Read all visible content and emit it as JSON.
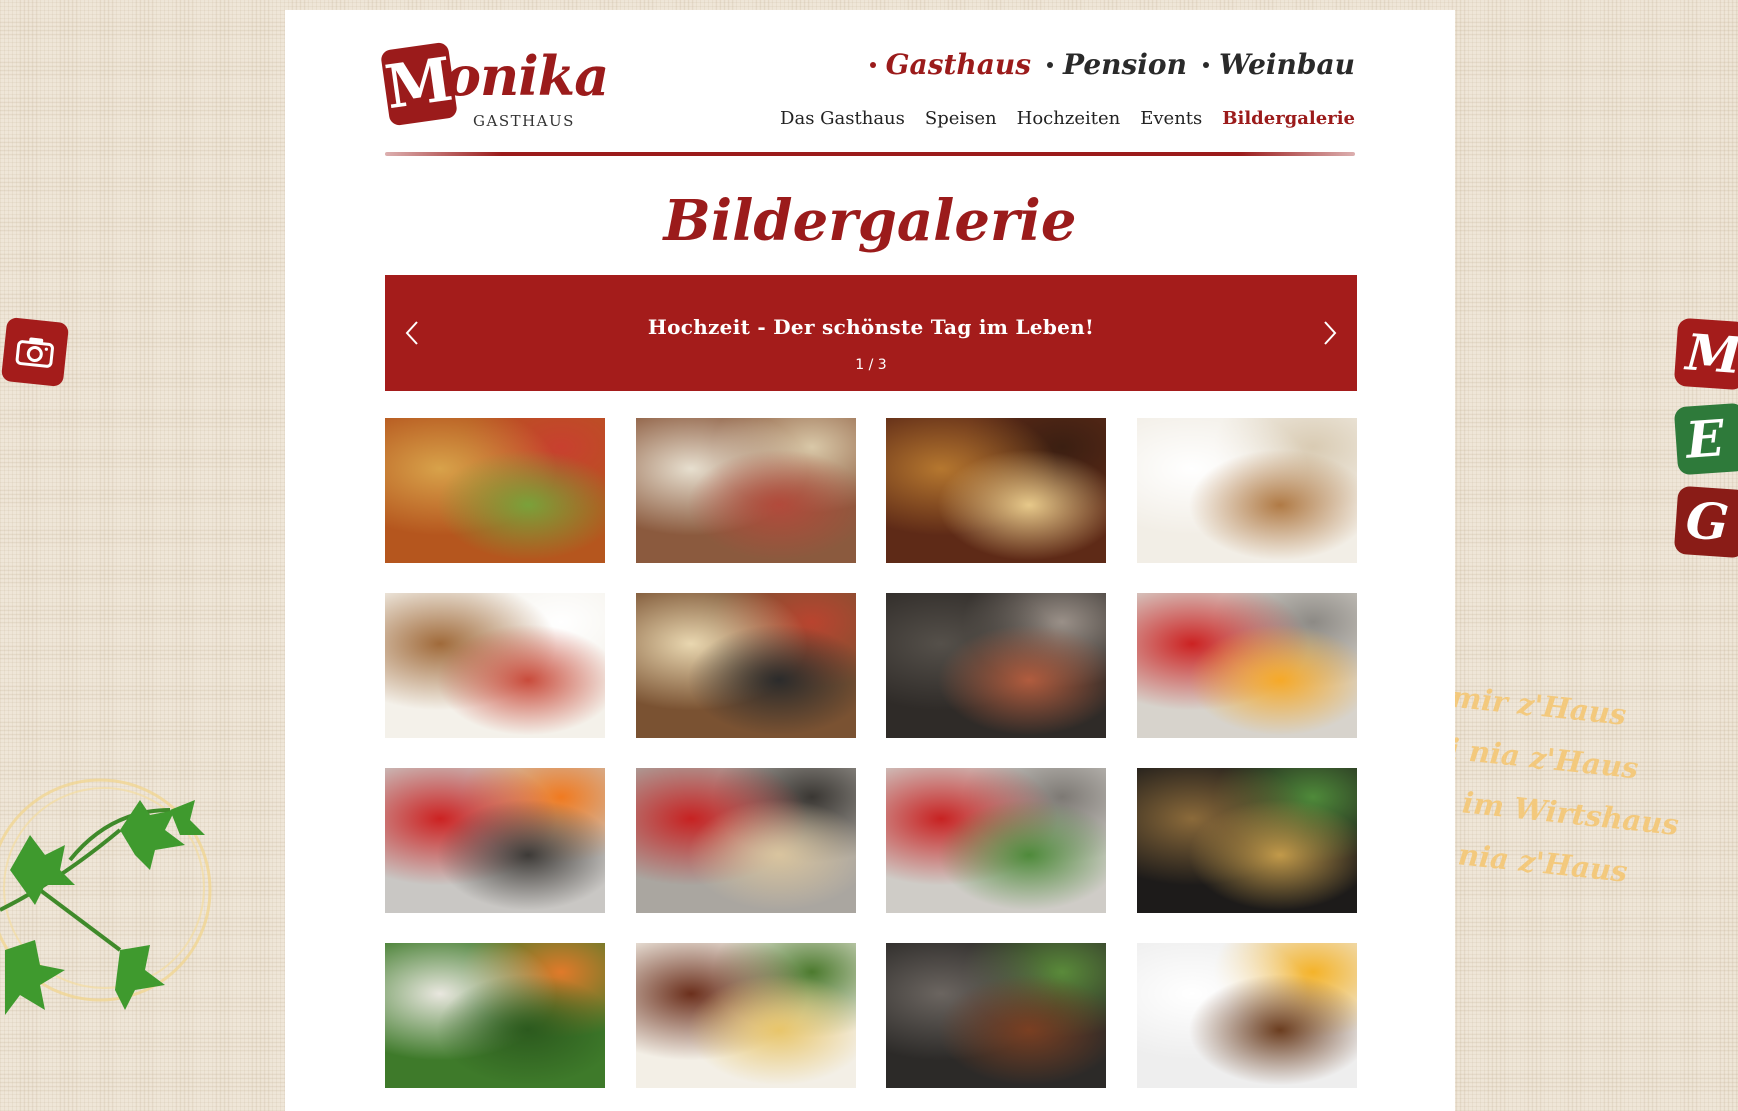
{
  "logo": {
    "initial": "M",
    "word": "onika",
    "subtitle": "GASTHAUS"
  },
  "topnav": [
    {
      "label": "Gasthaus",
      "active": true
    },
    {
      "label": "Pension",
      "active": false
    },
    {
      "label": "Weinbau",
      "active": false
    }
  ],
  "mainnav": [
    {
      "label": "Das Gasthaus",
      "active": false
    },
    {
      "label": "Speisen",
      "active": false
    },
    {
      "label": "Hochzeiten",
      "active": false
    },
    {
      "label": "Events",
      "active": false
    },
    {
      "label": "Bildergalerie",
      "active": true
    }
  ],
  "page_title": "Bildergalerie",
  "slider": {
    "title": "Hochzeit - Der schönste Tag im Leben!",
    "counter": "1 / 3"
  },
  "gallery": [
    {
      "subject": "restaurant-table",
      "colors": [
        "#b5561e",
        "#d8a24a",
        "#7aa13a",
        "#c8402f"
      ]
    },
    {
      "subject": "animal-figurines",
      "colors": [
        "#8b5a3e",
        "#e7dfcf",
        "#b24a3b",
        "#d9c8a8"
      ]
    },
    {
      "subject": "restaurant-bar",
      "colors": [
        "#5e2a17",
        "#b5772f",
        "#e7c98a",
        "#3b1f12"
      ]
    },
    {
      "subject": "teddy-chef-pot",
      "colors": [
        "#f2eee6",
        "#ffffff",
        "#b07a45",
        "#d9cbb3"
      ]
    },
    {
      "subject": "teddy-chef",
      "colors": [
        "#f4f1ea",
        "#a06a3a",
        "#c94b3b",
        "#ffffff"
      ]
    },
    {
      "subject": "willkommen-sign",
      "colors": [
        "#7a5232",
        "#e9d7b0",
        "#2b2b2b",
        "#b9442f"
      ]
    },
    {
      "subject": "frying-pan",
      "colors": [
        "#2f2b28",
        "#55504a",
        "#b15c3e",
        "#9a9088"
      ]
    },
    {
      "subject": "chef-flambe",
      "colors": [
        "#d7d3cc",
        "#cc2222",
        "#f6a928",
        "#8d8a85"
      ]
    },
    {
      "subject": "chef-stove",
      "colors": [
        "#c9c7c4",
        "#cc2222",
        "#3d3a37",
        "#f07a20"
      ]
    },
    {
      "subject": "chef-cooking",
      "colors": [
        "#aaa6a0",
        "#c72222",
        "#d9c49e",
        "#3a3733"
      ]
    },
    {
      "subject": "chef-kitchen",
      "colors": [
        "#cfccc7",
        "#c82222",
        "#4e8a3a",
        "#7d7974"
      ]
    },
    {
      "subject": "pan-dish",
      "colors": [
        "#1d1b1a",
        "#8b6a3a",
        "#c29a4a",
        "#4f8a3a"
      ]
    },
    {
      "subject": "vegetables",
      "colors": [
        "#3e7a2a",
        "#e9e7df",
        "#2c5a1e",
        "#e07a2a"
      ]
    },
    {
      "subject": "plated-steak",
      "colors": [
        "#f3efe6",
        "#6b2f1c",
        "#e8c56a",
        "#4c7a2e"
      ]
    },
    {
      "subject": "stove-pans",
      "colors": [
        "#2c2a28",
        "#6b6560",
        "#7a3f22",
        "#5a8a3a"
      ]
    },
    {
      "subject": "fried-egg-dish",
      "colors": [
        "#eeeeee",
        "#ffffff",
        "#6b3d1f",
        "#f4b32a"
      ]
    }
  ],
  "side_badges": [
    {
      "letter": "M",
      "color": "#a41c1b"
    },
    {
      "letter": "E",
      "color": "#2e7a3a"
    },
    {
      "letter": "G",
      "color": "#8a1c17"
    }
  ],
  "saying": [
    "Bei mir z'Haus",
    "Bin i nia z'Haus",
    "Aber im Wirtshaus",
    "Bin i nia z'Haus"
  ],
  "colors": {
    "brand_red": "#a41c1b",
    "text_dark": "#2a2a2a",
    "saying_yellow": "#f3c97d"
  }
}
